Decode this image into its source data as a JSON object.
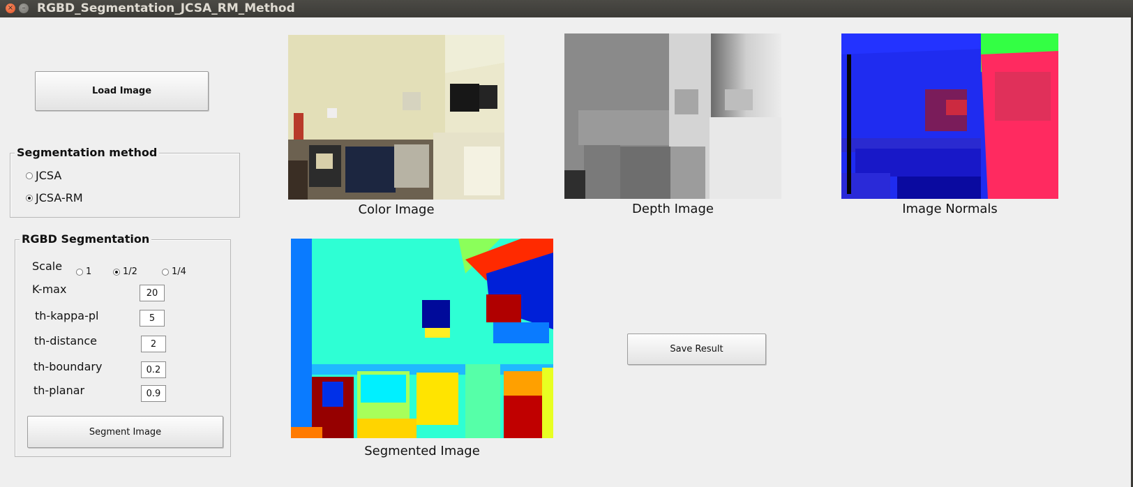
{
  "window": {
    "title": "RGBD_Segmentation_JCSA_RM_Method"
  },
  "left_panel": {
    "load_button": "Load Image",
    "segmentation_method": {
      "title": "Segmentation method",
      "options": [
        "JCSA",
        "JCSA-RM"
      ],
      "selected": "JCSA-RM"
    },
    "rgbd_segmentation": {
      "title": "RGBD Segmentation",
      "scale_label": "Scale",
      "scale_options": [
        "1",
        "1/2",
        "1/4"
      ],
      "scale_selected": "1/2",
      "params": [
        {
          "label": "K-max",
          "value": "20"
        },
        {
          "label": "th-kappa-pl",
          "value": "5"
        },
        {
          "label": "th-distance",
          "value": "2"
        },
        {
          "label": "th-boundary",
          "value": "0.2"
        },
        {
          "label": "th-planar",
          "value": "0.9"
        }
      ],
      "segment_button": "Segment Image"
    }
  },
  "images": {
    "color": {
      "caption": "Color Image"
    },
    "depth": {
      "caption": "Depth Image"
    },
    "normals": {
      "caption": "Image Normals"
    },
    "segmented": {
      "caption": "Segmented Image"
    }
  },
  "save_button": "Save Result"
}
